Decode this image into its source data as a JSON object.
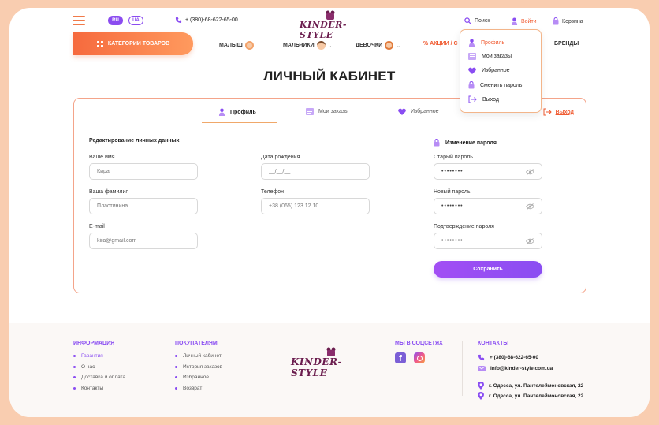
{
  "header": {
    "lang_ru": "RU",
    "lang_ua": "UA",
    "phone": "+ (380)-68-622-65-00",
    "logo": "KINDER-STYLE",
    "search": "Поиск",
    "login": "Войти",
    "cart": "Корзина"
  },
  "nav": {
    "categories_button": "КАТЕГОРИИ ТОВАРОВ",
    "items": [
      "МАЛЫШ",
      "МАЛЬЧИКИ",
      "ДЕВОЧКИ",
      "% АКЦИИ / С",
      "БРЕНДЫ"
    ]
  },
  "account_menu": {
    "items": [
      "Профиль",
      "Мои заказы",
      "Избранное",
      "Сменить пароль",
      "Выход"
    ],
    "active": "Профиль"
  },
  "page": {
    "title": "ЛИЧНЫЙ КАБИНЕТ",
    "tabs": [
      "Профиль",
      "Мои заказы",
      "Избранное"
    ],
    "exit": "Выход"
  },
  "profile_form": {
    "section_title": "Редактирование личных данных",
    "first_name": {
      "label": "Ваше имя",
      "placeholder": "Кира"
    },
    "last_name": {
      "label": "Ваша фамилия",
      "placeholder": "Пластинина"
    },
    "email": {
      "label": "E-mail",
      "placeholder": "kira@gmail.com"
    },
    "birth_date": {
      "label": "Дата рождения",
      "placeholder": "__/__/__"
    },
    "phone": {
      "label": "Телефон",
      "placeholder": "+38 (065) 123 12 10"
    }
  },
  "password_form": {
    "section_title": "Изменение пароля",
    "old_password": {
      "label": "Старый пароль",
      "value": "••••••••"
    },
    "new_password": {
      "label": "Новый пароль",
      "value": "••••••••"
    },
    "confirm_password": {
      "label": "Подтверждение пароля",
      "value": "••••••••"
    },
    "save_button": "Сохранить"
  },
  "footer": {
    "info": {
      "title": "ИНФОРМАЦИЯ",
      "items": [
        "Гарантия",
        "О нас",
        "Доставка и оплата",
        "Контакты"
      ]
    },
    "buyers": {
      "title": "ПОКУПАТЕЛЯМ",
      "items": [
        "Личный кабинет",
        "История заказов",
        "Избранное",
        "Возврат"
      ]
    },
    "logo": "KINDER-STYLE",
    "social": {
      "title": "МЫ В СОЦСЕТЯХ"
    },
    "contacts": {
      "title": "КОНТАКТЫ",
      "phone": "+ (380)-68-622-65-00",
      "email": "info@kinder-style.com.ua",
      "address_1": "г. Одесса, ул. Пантелеймоновская, 22",
      "address_2": "г. Одесса, ул. Пантелеймоновская, 22"
    }
  },
  "colors": {
    "accent_orange": "#f66a3e",
    "accent_purple": "#8a4df2",
    "logo": "#6b1d4e"
  }
}
